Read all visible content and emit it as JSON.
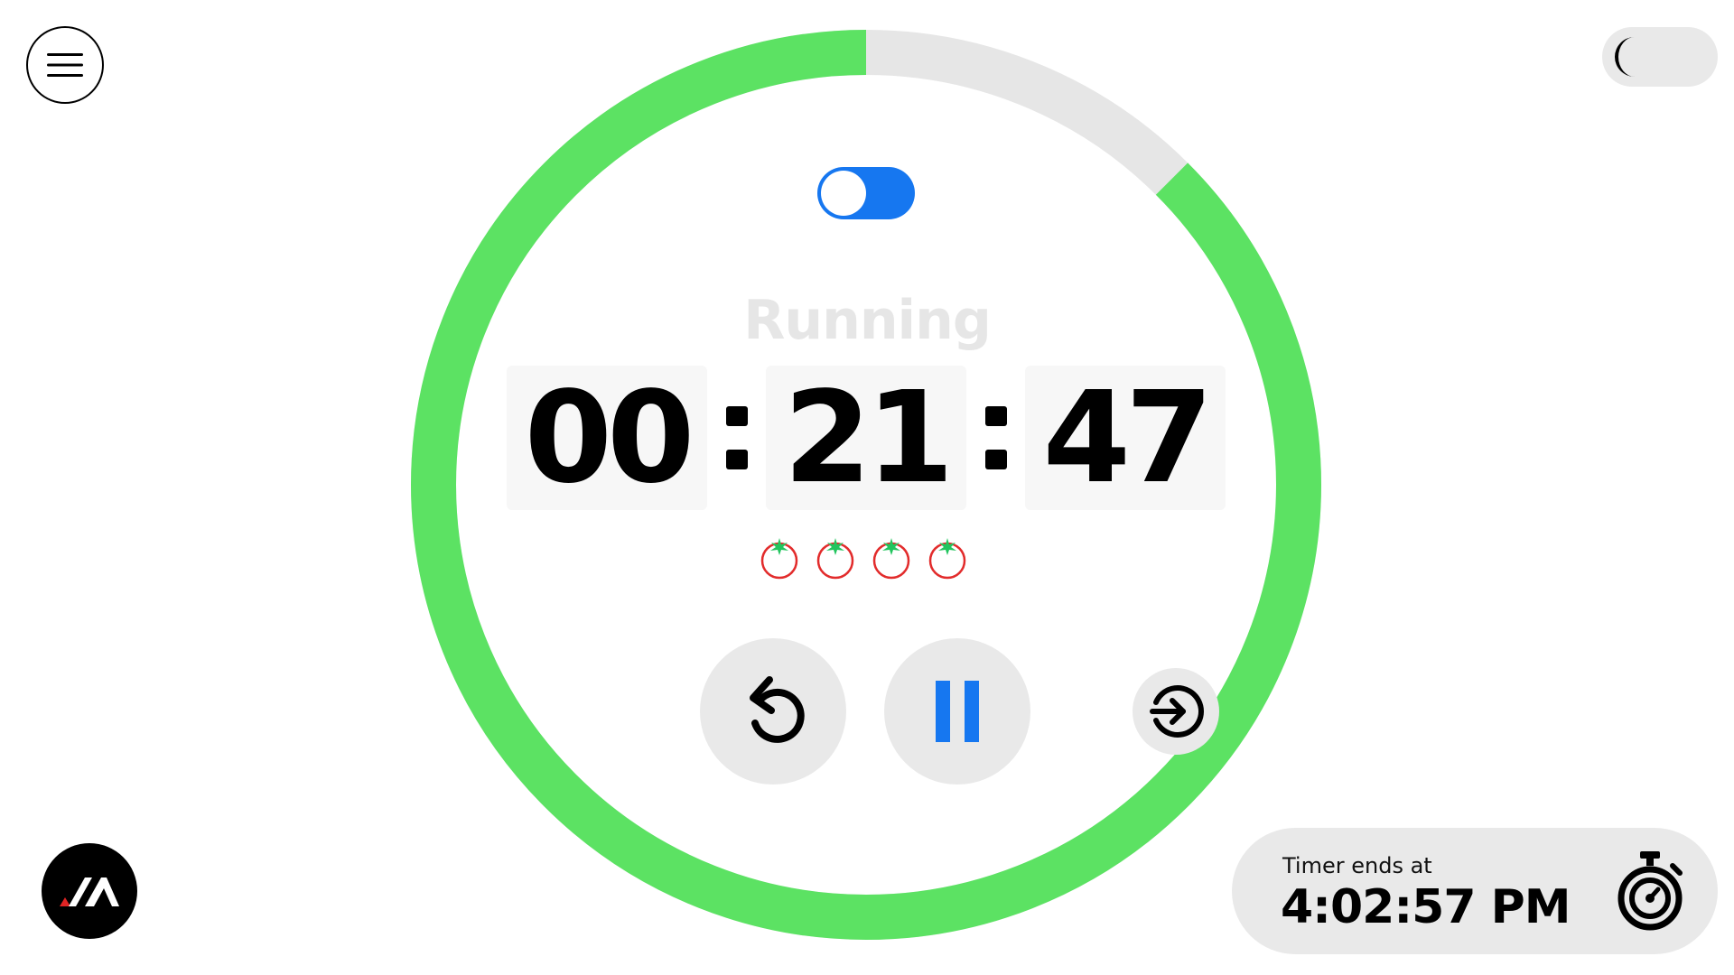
{
  "header": {
    "menu_icon": "hamburger-menu-icon",
    "theme_icon": "moon-icon"
  },
  "timer": {
    "progress_remaining_fraction": 0.875,
    "status": "Running",
    "hours": "00",
    "minutes": "21",
    "seconds": "47",
    "mode_toggle_on": true,
    "completed_pomodoros": 4,
    "tomato_icon": "tomato-icon"
  },
  "controls": {
    "reset_icon": "reset-icon",
    "pause_icon": "pause-icon",
    "skip_icon": "skip-icon"
  },
  "footer": {
    "end_label": "Timer ends at",
    "end_time": "4:02:57 PM",
    "stopwatch_icon": "stopwatch-icon",
    "logo_icon": "brand-logo-icon"
  },
  "colors": {
    "progress": "#5ce263",
    "track": "#e6e6e6",
    "accent": "#1677f0",
    "tomato_red": "#e22b2b",
    "tomato_leaf": "#22c55e",
    "status_text": "#e6e6e6"
  }
}
